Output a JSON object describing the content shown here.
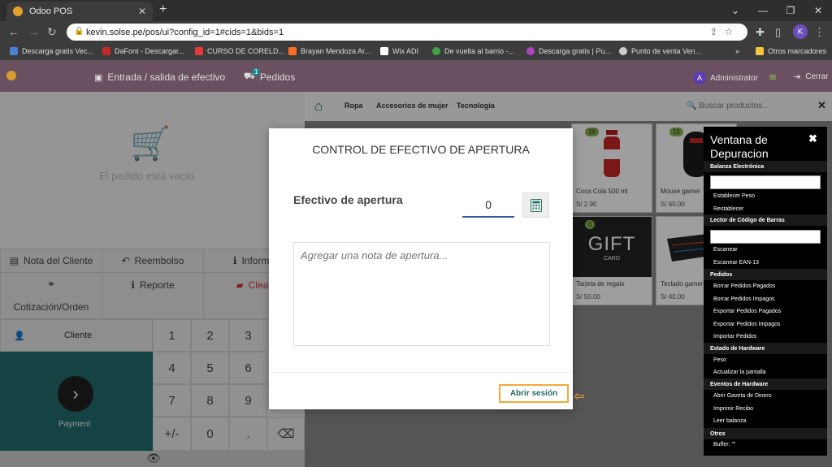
{
  "browser": {
    "tab_title": "Odoo POS",
    "url": "kevin.solse.pe/pos/ui?config_id=1#cids=1&bids=1",
    "profile_initial": "K",
    "bookmarks": [
      {
        "label": "Descarga gratis Vec...",
        "color": "#4a7fd4"
      },
      {
        "label": "DaFont - Descargar...",
        "color": "#c62828"
      },
      {
        "label": "CURSO DE CORELD...",
        "color": "#e53935"
      },
      {
        "label": "Brayan Mendoza Ar...",
        "color": "#fc6d26"
      },
      {
        "label": "Wix ADI",
        "color": "#ffffff"
      },
      {
        "label": "De vuelta al barrio -...",
        "color": "#43a047"
      },
      {
        "label": "Descarga gratis | Pu...",
        "color": "#ab47bc"
      },
      {
        "label": "Punto de venta Ven...",
        "color": "#cccccc"
      }
    ],
    "bookmarks_more": "»",
    "other_bookmarks": "Otros marcadores"
  },
  "pos_header": {
    "cash_in_out": "Entrada / salida de efectivo",
    "orders": "Pedidos",
    "orders_count": "1",
    "user": "Administrator",
    "user_initial": "A",
    "close": "Cerrar"
  },
  "left": {
    "empty_text": "El pedido está vacío",
    "customer_note": "Nota del Cliente",
    "refund": "Reembolso",
    "info": "Informa",
    "report": "Reporte",
    "clear": "Clear",
    "quotation": "Cotización/Orden",
    "customer": "Cliente",
    "payment": "Payment",
    "keys": [
      "1",
      "2",
      "3",
      "4",
      "5",
      "6",
      "7",
      "8",
      "9",
      "+/-",
      "0",
      "."
    ]
  },
  "categories": {
    "items": [
      "Ropa",
      "Accesorios de mujer",
      "Tecnología"
    ],
    "search_placeholder": "Buscar productos..."
  },
  "products": [
    {
      "name": "Coca Cola 500 ml",
      "price": "S/ 2.90",
      "qty": "28"
    },
    {
      "name": "Mouse gamer",
      "price": "S/ 60.00",
      "qty": "15"
    },
    {
      "name": "Tarjeta de regalo",
      "price": "S/ 50.00",
      "qty": "0"
    },
    {
      "name": "Teclado gamer",
      "price": "S/ 40.00",
      "qty": ""
    }
  ],
  "gift_card": {
    "big": "GIFT",
    "small": "CARD"
  },
  "modal": {
    "title": "CONTROL DE EFECTIVO DE APERTURA",
    "cash_label": "Efectivo de apertura",
    "cash_value": "0",
    "note_placeholder": "Agregar una nota de apertura...",
    "open_button": "Abrir sesión"
  },
  "debug": {
    "title": "Ventana de Depuracion",
    "sections": [
      {
        "title": "Balanza Electrónica",
        "items": [
          "Establecer Peso",
          "Restablecer"
        ]
      },
      {
        "title": "Lector de Código de Barras",
        "items": [
          "Escanear",
          "Escanear EAN-13"
        ]
      },
      {
        "title": "Pedidos",
        "items": [
          "Borrar Pedidos Pagados",
          "Borrar Pedidos Impagos",
          "Exportar Pedidos Pagados",
          "Exportar Pedidos Impagos",
          "Importar Pedidos"
        ]
      },
      {
        "title": "Estado de Hardware",
        "items": [
          "Peso",
          "Actualizar la pantalla"
        ]
      },
      {
        "title": "Eventos de Hardware",
        "items": [
          "Abrir Gaveta de Dinero",
          "Imprimir Recibo",
          "Leer balanza"
        ]
      },
      {
        "title": "Otros",
        "items": [
          "Buffer: \"\""
        ]
      }
    ]
  }
}
